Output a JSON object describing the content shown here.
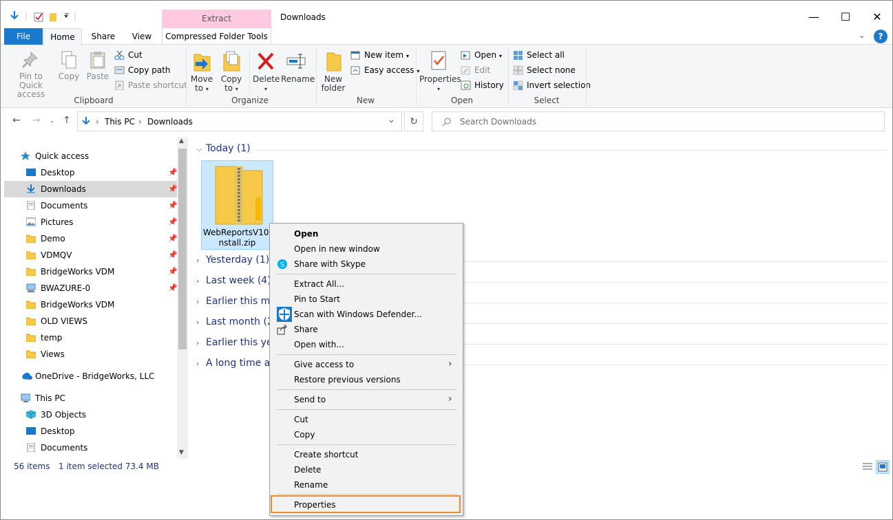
{
  "window": {
    "title": "Downloads",
    "contextual_group": "Extract",
    "controls": {
      "minimize": "—",
      "maximize": "☐",
      "close": "✕"
    }
  },
  "tabs": {
    "file": "File",
    "home": "Home",
    "share": "Share",
    "view": "View",
    "compressed": "Compressed Folder Tools",
    "help_icon": "?"
  },
  "ribbon": {
    "clipboard": {
      "pin_line1": "Pin to Quick",
      "pin_line2": "access",
      "copy": "Copy",
      "paste": "Paste",
      "cut": "Cut",
      "copy_path": "Copy path",
      "paste_shortcut": "Paste shortcut",
      "group": "Clipboard"
    },
    "organize": {
      "move_line1": "Move",
      "move_line2": "to",
      "copy_line1": "Copy",
      "copy_line2": "to",
      "delete": "Delete",
      "rename": "Rename",
      "group": "Organize"
    },
    "new": {
      "folder_line1": "New",
      "folder_line2": "folder",
      "new_item": "New item",
      "easy_access": "Easy access",
      "group": "New"
    },
    "open": {
      "properties": "Properties",
      "open": "Open",
      "edit": "Edit",
      "history": "History",
      "group": "Open"
    },
    "select": {
      "select_all": "Select all",
      "select_none": "Select none",
      "invert": "Invert selection",
      "group": "Select"
    }
  },
  "address": {
    "segments": [
      "This PC",
      "Downloads"
    ],
    "search_placeholder": "Search Downloads"
  },
  "nav_pane": {
    "quick_access": "Quick access",
    "items": [
      {
        "label": "Desktop",
        "pinned": true
      },
      {
        "label": "Downloads",
        "pinned": true
      },
      {
        "label": "Documents",
        "pinned": true
      },
      {
        "label": "Pictures",
        "pinned": true
      },
      {
        "label": "Demo",
        "pinned": true
      },
      {
        "label": "VDMQV",
        "pinned": true
      },
      {
        "label": "BridgeWorks VDM",
        "pinned": true
      },
      {
        "label": "BWAZURE-0",
        "pinned": true
      },
      {
        "label": "BridgeWorks VDM",
        "pinned": false
      },
      {
        "label": "OLD VIEWS",
        "pinned": false
      },
      {
        "label": "temp",
        "pinned": false
      },
      {
        "label": "Views",
        "pinned": false
      }
    ],
    "onedrive": "OneDrive - BridgeWorks, LLC",
    "this_pc": "This PC",
    "pc_items": [
      "3D Objects",
      "Desktop",
      "Documents"
    ]
  },
  "content": {
    "groups": [
      "Today (1)",
      "Yesterday (1)",
      "Last week (4)",
      "Earlier this mo",
      "Last month (2",
      "Earlier this yea",
      "A long time ag"
    ],
    "file": {
      "line1": "WebReportsV10I",
      "line2": "nstall.zip"
    }
  },
  "status": {
    "count": "56 items",
    "selection": "1 item selected  73.4 MB"
  },
  "context_menu": {
    "open": "Open",
    "open_new_window": "Open in new window",
    "share_skype": "Share with Skype",
    "extract_all": "Extract All...",
    "pin_start": "Pin to Start",
    "scan_defender": "Scan with Windows Defender...",
    "share": "Share",
    "open_with": "Open with...",
    "give_access": "Give access to",
    "restore": "Restore previous versions",
    "send_to": "Send to",
    "cut": "Cut",
    "copy": "Copy",
    "create_shortcut": "Create shortcut",
    "delete": "Delete",
    "rename": "Rename",
    "properties": "Properties",
    "highlight_color": "#f08a24"
  }
}
